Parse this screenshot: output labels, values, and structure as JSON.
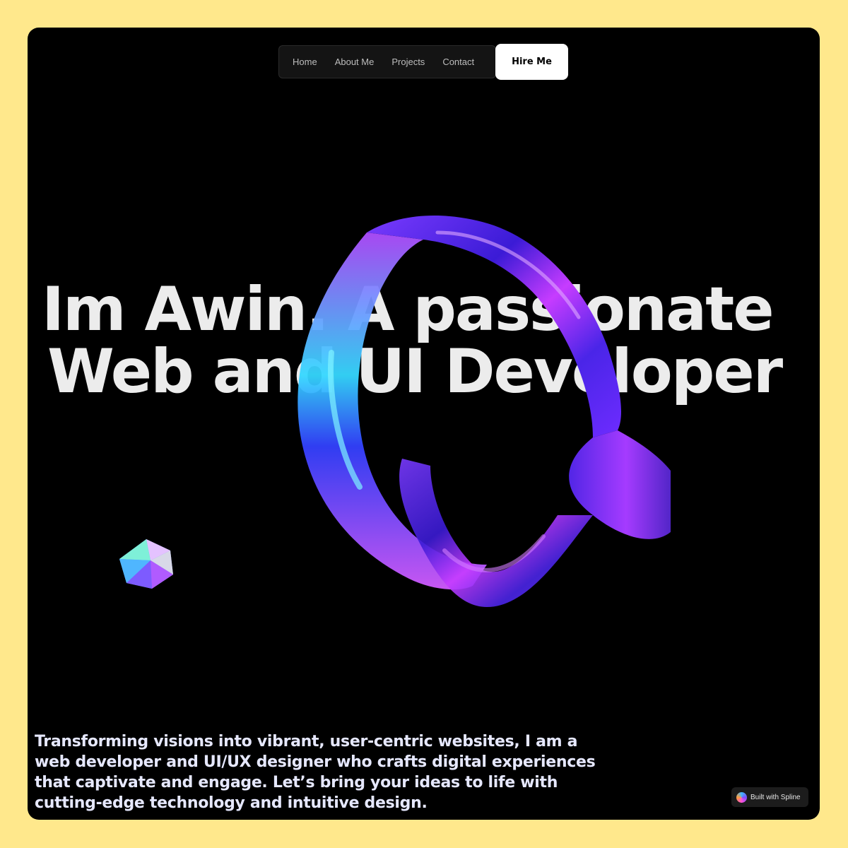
{
  "nav": {
    "items": [
      {
        "label": "Home"
      },
      {
        "label": "About Me"
      },
      {
        "label": "Projects"
      },
      {
        "label": "Contact"
      }
    ],
    "cta_label": "Hire Me"
  },
  "hero": {
    "headline_line1": "Im Awin. A passionate",
    "headline_line2": "Web and UI Developer",
    "description": "Transforming visions into vibrant, user-centric websites, I am a web developer and UI/UX designer who crafts digital experiences that captivate and engage. Let’s bring your ideas to life with cutting-edge technology and intuitive design."
  },
  "badge": {
    "label": "Built with Spline"
  },
  "colors": {
    "page_bg": "#ffe88c",
    "frame_bg": "#000000",
    "accent_purple": "#6a2cff",
    "accent_cyan": "#31d6ff"
  },
  "icons": {
    "ribbon": "3d-ribbon-graphic",
    "gem": "icosahedron-gem",
    "badge_logo": "spline-logo-icon"
  }
}
